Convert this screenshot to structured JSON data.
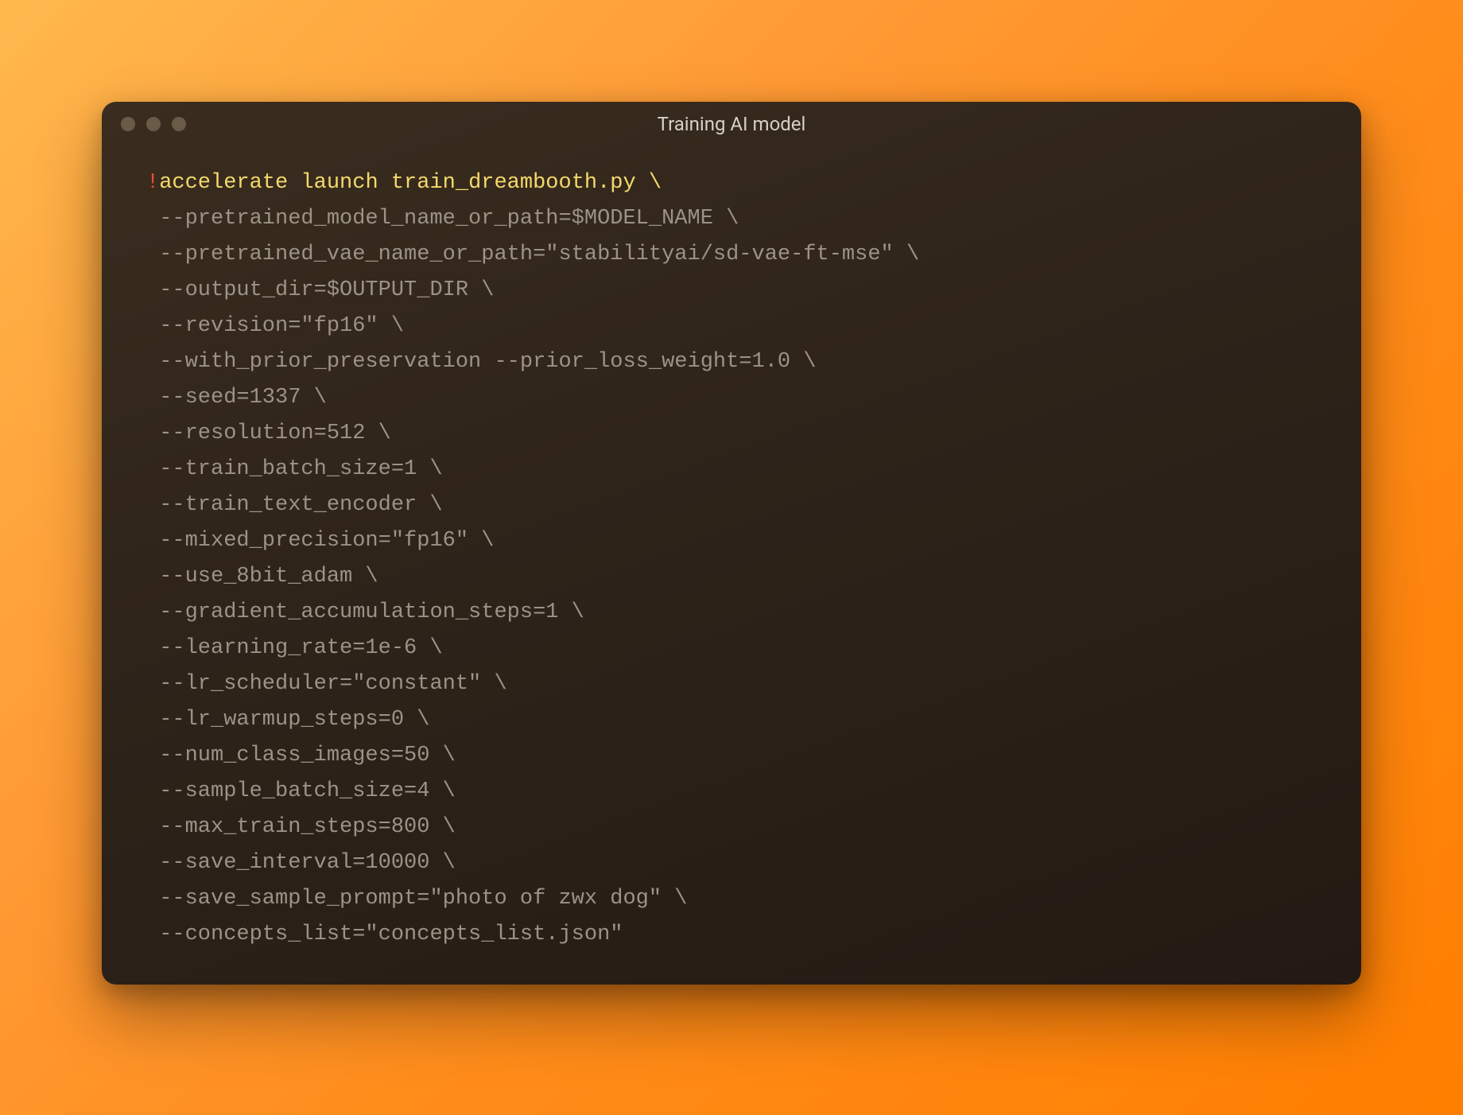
{
  "window": {
    "title": "Training AI model"
  },
  "code": {
    "bang": "!",
    "command": "accelerate launch train_dreambooth.py",
    "command_cont": " \\",
    "args": [
      "--pretrained_model_name_or_path=$MODEL_NAME \\",
      "--pretrained_vae_name_or_path=\"stabilityai/sd-vae-ft-mse\" \\",
      "--output_dir=$OUTPUT_DIR \\",
      "--revision=\"fp16\" \\",
      "--with_prior_preservation --prior_loss_weight=1.0 \\",
      "--seed=1337 \\",
      "--resolution=512 \\",
      "--train_batch_size=1 \\",
      "--train_text_encoder \\",
      "--mixed_precision=\"fp16\" \\",
      "--use_8bit_adam \\",
      "--gradient_accumulation_steps=1 \\",
      "--learning_rate=1e-6 \\",
      "--lr_scheduler=\"constant\" \\",
      "--lr_warmup_steps=0 \\",
      "--num_class_images=50 \\",
      "--sample_batch_size=4 \\",
      "--max_train_steps=800 \\",
      "--save_interval=10000 \\",
      "--save_sample_prompt=\"photo of zwx dog\" \\",
      "--concepts_list=\"concepts_list.json\""
    ]
  }
}
